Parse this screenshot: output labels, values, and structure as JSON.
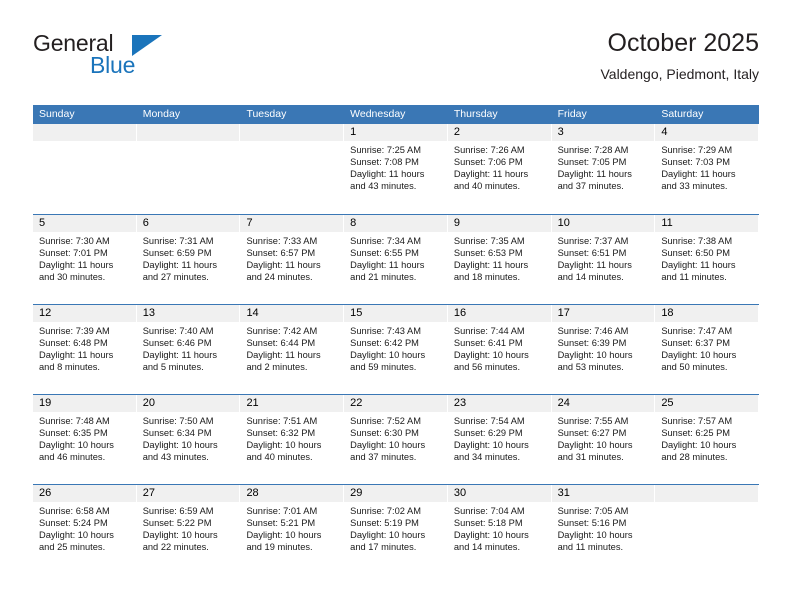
{
  "brand": {
    "name_part1": "General",
    "name_part2": "Blue",
    "triangle_color": "#1a74bb"
  },
  "header": {
    "title": "October 2025",
    "subtitle": "Valdengo, Piedmont, Italy"
  },
  "theme": {
    "header_blue": "#3a77b5",
    "datebar_gray": "#f0f0f0",
    "text_black": "#231f20"
  },
  "weekdays": [
    "Sunday",
    "Monday",
    "Tuesday",
    "Wednesday",
    "Thursday",
    "Friday",
    "Saturday"
  ],
  "weeks": [
    [
      {
        "day": "",
        "blank": true,
        "sunrise": "",
        "sunset": "",
        "daylight1": "",
        "daylight2": ""
      },
      {
        "day": "",
        "blank": true,
        "sunrise": "",
        "sunset": "",
        "daylight1": "",
        "daylight2": ""
      },
      {
        "day": "",
        "blank": true,
        "sunrise": "",
        "sunset": "",
        "daylight1": "",
        "daylight2": ""
      },
      {
        "day": "1",
        "sunrise": "Sunrise: 7:25 AM",
        "sunset": "Sunset: 7:08 PM",
        "daylight1": "Daylight: 11 hours",
        "daylight2": "and 43 minutes."
      },
      {
        "day": "2",
        "sunrise": "Sunrise: 7:26 AM",
        "sunset": "Sunset: 7:06 PM",
        "daylight1": "Daylight: 11 hours",
        "daylight2": "and 40 minutes."
      },
      {
        "day": "3",
        "sunrise": "Sunrise: 7:28 AM",
        "sunset": "Sunset: 7:05 PM",
        "daylight1": "Daylight: 11 hours",
        "daylight2": "and 37 minutes."
      },
      {
        "day": "4",
        "sunrise": "Sunrise: 7:29 AM",
        "sunset": "Sunset: 7:03 PM",
        "daylight1": "Daylight: 11 hours",
        "daylight2": "and 33 minutes."
      }
    ],
    [
      {
        "day": "5",
        "sunrise": "Sunrise: 7:30 AM",
        "sunset": "Sunset: 7:01 PM",
        "daylight1": "Daylight: 11 hours",
        "daylight2": "and 30 minutes."
      },
      {
        "day": "6",
        "sunrise": "Sunrise: 7:31 AM",
        "sunset": "Sunset: 6:59 PM",
        "daylight1": "Daylight: 11 hours",
        "daylight2": "and 27 minutes."
      },
      {
        "day": "7",
        "sunrise": "Sunrise: 7:33 AM",
        "sunset": "Sunset: 6:57 PM",
        "daylight1": "Daylight: 11 hours",
        "daylight2": "and 24 minutes."
      },
      {
        "day": "8",
        "sunrise": "Sunrise: 7:34 AM",
        "sunset": "Sunset: 6:55 PM",
        "daylight1": "Daylight: 11 hours",
        "daylight2": "and 21 minutes."
      },
      {
        "day": "9",
        "sunrise": "Sunrise: 7:35 AM",
        "sunset": "Sunset: 6:53 PM",
        "daylight1": "Daylight: 11 hours",
        "daylight2": "and 18 minutes."
      },
      {
        "day": "10",
        "sunrise": "Sunrise: 7:37 AM",
        "sunset": "Sunset: 6:51 PM",
        "daylight1": "Daylight: 11 hours",
        "daylight2": "and 14 minutes."
      },
      {
        "day": "11",
        "sunrise": "Sunrise: 7:38 AM",
        "sunset": "Sunset: 6:50 PM",
        "daylight1": "Daylight: 11 hours",
        "daylight2": "and 11 minutes."
      }
    ],
    [
      {
        "day": "12",
        "sunrise": "Sunrise: 7:39 AM",
        "sunset": "Sunset: 6:48 PM",
        "daylight1": "Daylight: 11 hours",
        "daylight2": "and 8 minutes."
      },
      {
        "day": "13",
        "sunrise": "Sunrise: 7:40 AM",
        "sunset": "Sunset: 6:46 PM",
        "daylight1": "Daylight: 11 hours",
        "daylight2": "and 5 minutes."
      },
      {
        "day": "14",
        "sunrise": "Sunrise: 7:42 AM",
        "sunset": "Sunset: 6:44 PM",
        "daylight1": "Daylight: 11 hours",
        "daylight2": "and 2 minutes."
      },
      {
        "day": "15",
        "sunrise": "Sunrise: 7:43 AM",
        "sunset": "Sunset: 6:42 PM",
        "daylight1": "Daylight: 10 hours",
        "daylight2": "and 59 minutes."
      },
      {
        "day": "16",
        "sunrise": "Sunrise: 7:44 AM",
        "sunset": "Sunset: 6:41 PM",
        "daylight1": "Daylight: 10 hours",
        "daylight2": "and 56 minutes."
      },
      {
        "day": "17",
        "sunrise": "Sunrise: 7:46 AM",
        "sunset": "Sunset: 6:39 PM",
        "daylight1": "Daylight: 10 hours",
        "daylight2": "and 53 minutes."
      },
      {
        "day": "18",
        "sunrise": "Sunrise: 7:47 AM",
        "sunset": "Sunset: 6:37 PM",
        "daylight1": "Daylight: 10 hours",
        "daylight2": "and 50 minutes."
      }
    ],
    [
      {
        "day": "19",
        "sunrise": "Sunrise: 7:48 AM",
        "sunset": "Sunset: 6:35 PM",
        "daylight1": "Daylight: 10 hours",
        "daylight2": "and 46 minutes."
      },
      {
        "day": "20",
        "sunrise": "Sunrise: 7:50 AM",
        "sunset": "Sunset: 6:34 PM",
        "daylight1": "Daylight: 10 hours",
        "daylight2": "and 43 minutes."
      },
      {
        "day": "21",
        "sunrise": "Sunrise: 7:51 AM",
        "sunset": "Sunset: 6:32 PM",
        "daylight1": "Daylight: 10 hours",
        "daylight2": "and 40 minutes."
      },
      {
        "day": "22",
        "sunrise": "Sunrise: 7:52 AM",
        "sunset": "Sunset: 6:30 PM",
        "daylight1": "Daylight: 10 hours",
        "daylight2": "and 37 minutes."
      },
      {
        "day": "23",
        "sunrise": "Sunrise: 7:54 AM",
        "sunset": "Sunset: 6:29 PM",
        "daylight1": "Daylight: 10 hours",
        "daylight2": "and 34 minutes."
      },
      {
        "day": "24",
        "sunrise": "Sunrise: 7:55 AM",
        "sunset": "Sunset: 6:27 PM",
        "daylight1": "Daylight: 10 hours",
        "daylight2": "and 31 minutes."
      },
      {
        "day": "25",
        "sunrise": "Sunrise: 7:57 AM",
        "sunset": "Sunset: 6:25 PM",
        "daylight1": "Daylight: 10 hours",
        "daylight2": "and 28 minutes."
      }
    ],
    [
      {
        "day": "26",
        "sunrise": "Sunrise: 6:58 AM",
        "sunset": "Sunset: 5:24 PM",
        "daylight1": "Daylight: 10 hours",
        "daylight2": "and 25 minutes."
      },
      {
        "day": "27",
        "sunrise": "Sunrise: 6:59 AM",
        "sunset": "Sunset: 5:22 PM",
        "daylight1": "Daylight: 10 hours",
        "daylight2": "and 22 minutes."
      },
      {
        "day": "28",
        "sunrise": "Sunrise: 7:01 AM",
        "sunset": "Sunset: 5:21 PM",
        "daylight1": "Daylight: 10 hours",
        "daylight2": "and 19 minutes."
      },
      {
        "day": "29",
        "sunrise": "Sunrise: 7:02 AM",
        "sunset": "Sunset: 5:19 PM",
        "daylight1": "Daylight: 10 hours",
        "daylight2": "and 17 minutes."
      },
      {
        "day": "30",
        "sunrise": "Sunrise: 7:04 AM",
        "sunset": "Sunset: 5:18 PM",
        "daylight1": "Daylight: 10 hours",
        "daylight2": "and 14 minutes."
      },
      {
        "day": "31",
        "sunrise": "Sunrise: 7:05 AM",
        "sunset": "Sunset: 5:16 PM",
        "daylight1": "Daylight: 10 hours",
        "daylight2": "and 11 minutes."
      },
      {
        "day": "",
        "blank": true,
        "sunrise": "",
        "sunset": "",
        "daylight1": "",
        "daylight2": ""
      }
    ]
  ]
}
